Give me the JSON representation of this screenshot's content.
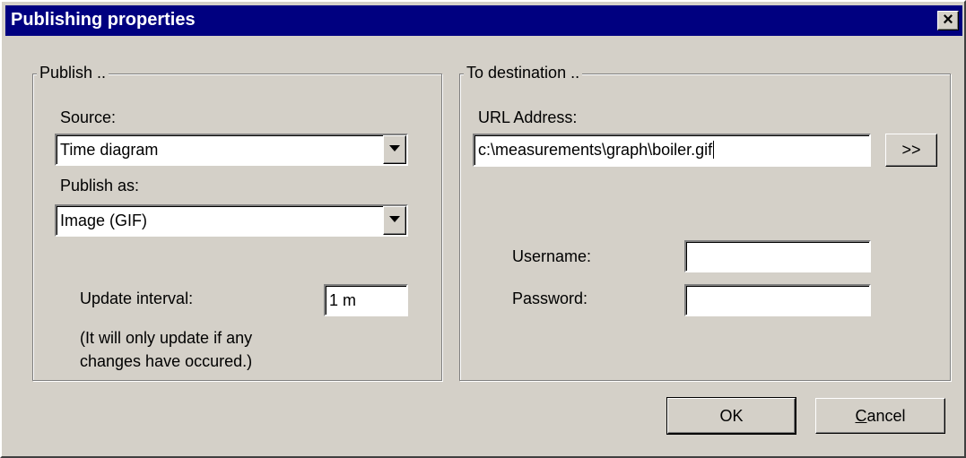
{
  "window": {
    "title": "Publishing properties",
    "close_label": "×"
  },
  "publish_group": {
    "label": "Publish ..",
    "source_label": "Source:",
    "source_value": "Time diagram",
    "publish_as_label": "Publish as:",
    "publish_as_value": "Image (GIF)",
    "update_interval_label": "Update interval:",
    "update_interval_value": "1 m",
    "note_line1": "(It will only update if any",
    "note_line2": "changes have occured.)"
  },
  "destination_group": {
    "label": "To destination ..",
    "url_label": "URL Address:",
    "url_value": "c:\\measurements\\graph\\boiler.gif",
    "browse_label": ">>",
    "username_label": "Username:",
    "username_value": "",
    "password_label": "Password:",
    "password_value": ""
  },
  "buttons": {
    "ok_label": "OK",
    "cancel_first": "C",
    "cancel_rest": "ancel"
  },
  "colors": {
    "titlebar": "#000080",
    "face": "#d4d0c8"
  },
  "icons": {
    "close": "close-icon",
    "dropdown": "chevron-down-icon"
  }
}
